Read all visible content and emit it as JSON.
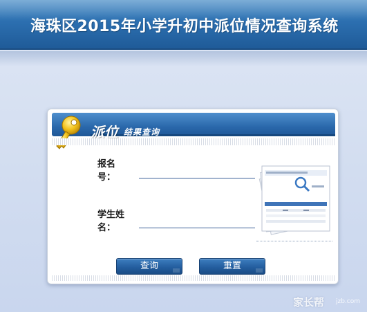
{
  "header": {
    "title": "海珠区2015年小学升初中派位情况查询系统"
  },
  "panel": {
    "title_main": "派位",
    "title_sub": "结果查询",
    "key_icon": "key-icon"
  },
  "form": {
    "fields": [
      {
        "label": "报名号：",
        "value": ""
      },
      {
        "label": "学生姓名：",
        "value": ""
      }
    ],
    "query_label": "查询",
    "reset_label": "重置"
  },
  "illustration": {
    "icon": "document-stack-icon"
  },
  "watermark": {
    "text": "家长帮",
    "sub": "jzb.com"
  },
  "colors": {
    "header_blue": "#2c6fb0",
    "button_blue": "#245e9f",
    "background": "#d2ddf0"
  }
}
